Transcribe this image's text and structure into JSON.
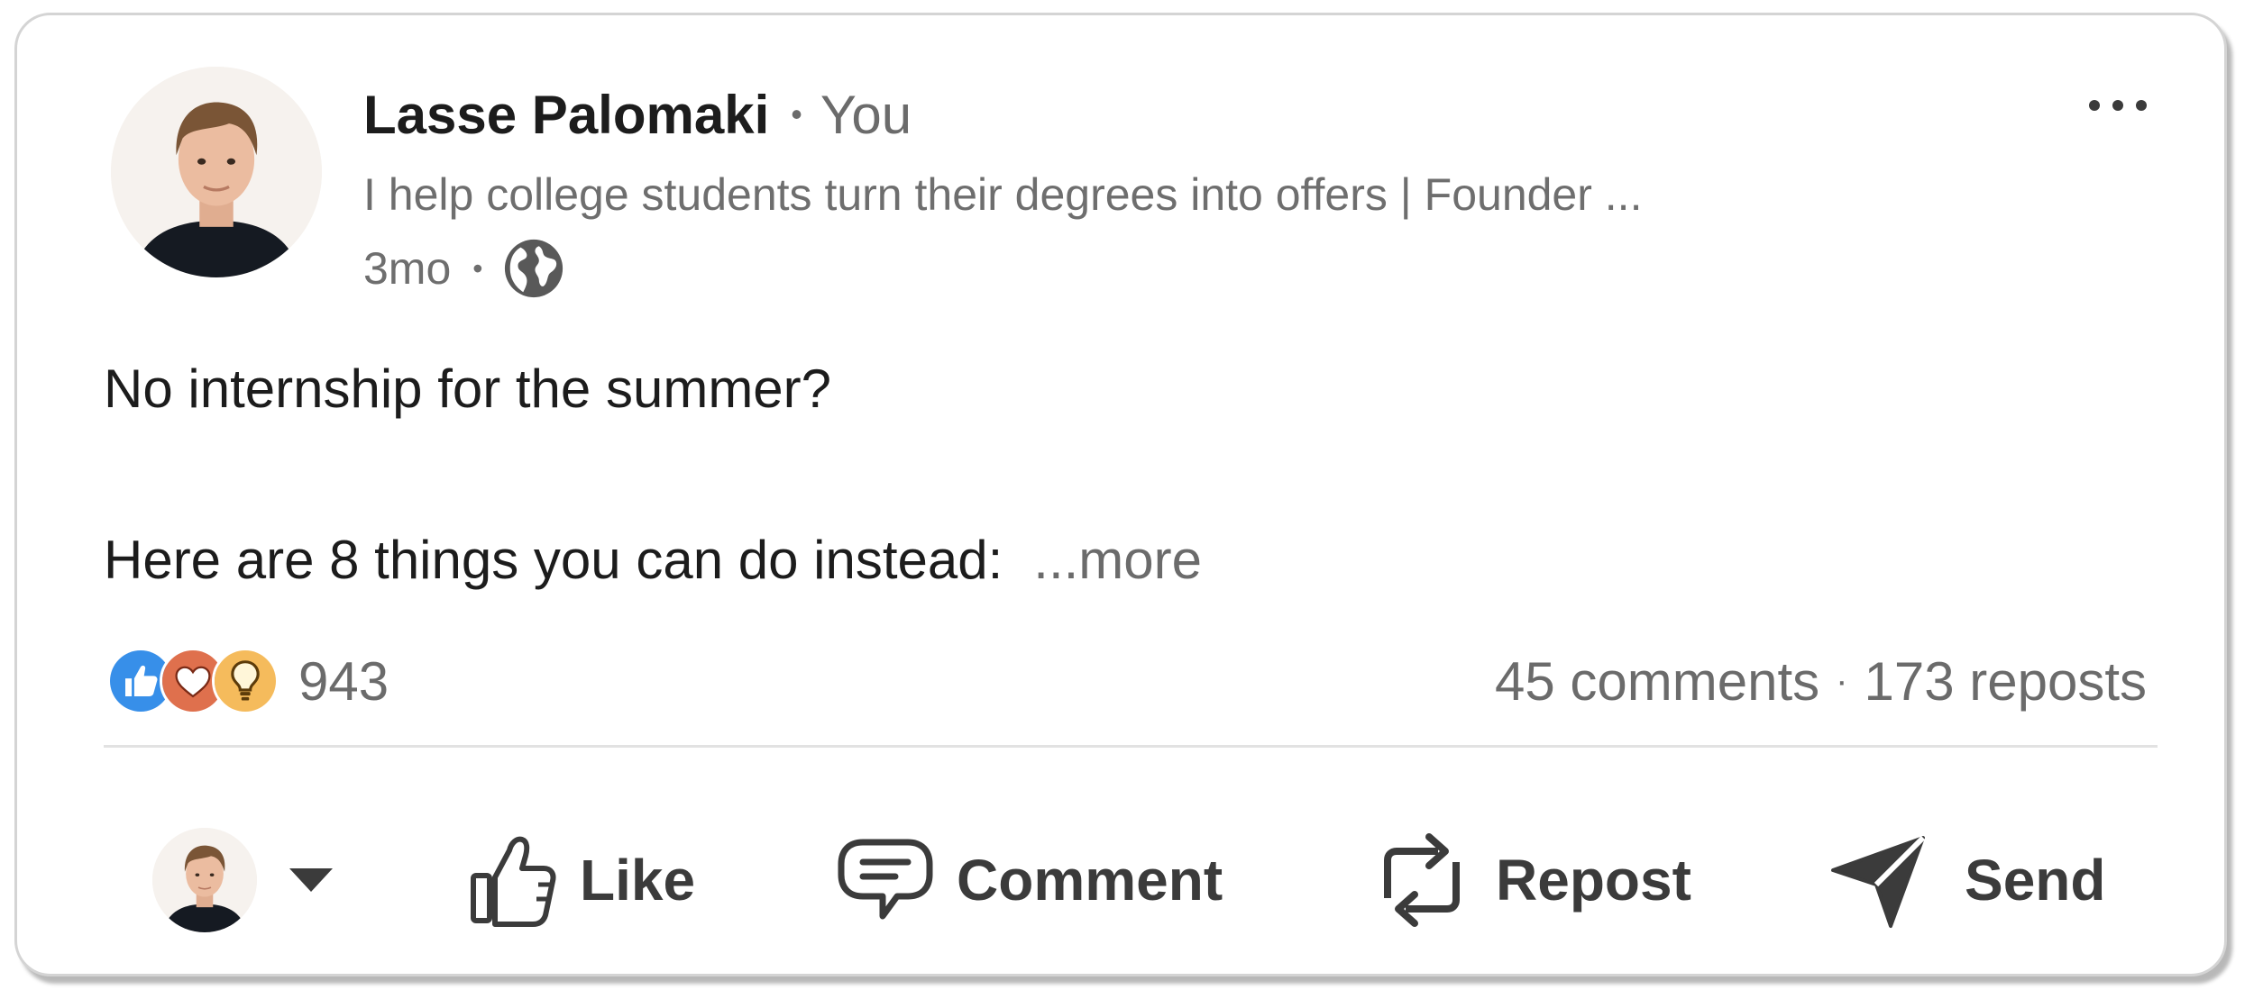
{
  "post": {
    "author_name": "Lasse Palomaki",
    "separator": "•",
    "relationship": "You",
    "headline": "I help college students turn their degrees into offers | Founder ...",
    "age": "3mo",
    "meta_separator": "•",
    "visibility_icon": "globe-icon",
    "more_menu_icon": "ellipsis-icon",
    "text_line_1": "No internship for the summer?",
    "text_line_2": "Here are 8 things you can do instead:",
    "see_more_label": "...more"
  },
  "social": {
    "reaction_icons": [
      "like-reaction-icon",
      "love-reaction-icon",
      "insightful-reaction-icon"
    ],
    "reaction_count": "943",
    "comments": "45 comments",
    "stats_separator": "·",
    "reposts": "173 reposts"
  },
  "actions": {
    "like_label": "Like",
    "comment_label": "Comment",
    "repost_label": "Repost",
    "send_label": "Send"
  },
  "colors": {
    "like_blue": "#378fe9",
    "love_red": "#df704d",
    "insightful_yellow": "#f5bb5c",
    "text_primary": "#1c1c1c",
    "text_secondary": "#6b6b6b",
    "action_gray": "#3b3b3b"
  }
}
